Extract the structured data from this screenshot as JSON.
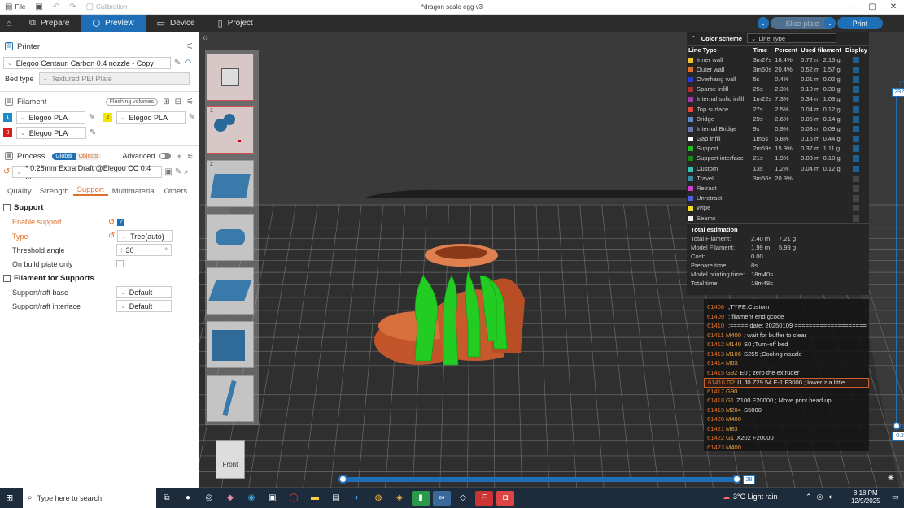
{
  "menubar": {
    "file": "File",
    "calibration": "Calibration",
    "doc_title": "*dragon scale egg v3"
  },
  "tabs": [
    {
      "label": "Prepare"
    },
    {
      "label": "Preview"
    },
    {
      "label": "Device"
    },
    {
      "label": "Project"
    }
  ],
  "toolbar": {
    "slice_label": "Slice plate",
    "print_label": "Print"
  },
  "printer": {
    "section_title": "Printer",
    "profile": "Elegoo Centauri Carbon 0.4 nozzle - Copy",
    "bed_type_label": "Bed type",
    "bed_type_value": "Textured PEI Plate"
  },
  "filament": {
    "section_title": "Filament",
    "flushing_label": "Flushing volumes",
    "slots": [
      {
        "num": "1",
        "name": "Elegoo PLA",
        "color": "#1f8bc4"
      },
      {
        "num": "2",
        "name": "Elegoo PLA",
        "color": "#f2e600"
      },
      {
        "num": "3",
        "name": "Elegoo PLA",
        "color": "#d61c1c"
      }
    ]
  },
  "process": {
    "section_title": "Process",
    "global_label": "Global",
    "objects_label": "Objects",
    "advanced_label": "Advanced",
    "profile": "* 0.28mm Extra Draft @Elegoo CC 0.4 ...",
    "subtabs": [
      "Quality",
      "Strength",
      "Support",
      "Multimaterial",
      "Others"
    ]
  },
  "support": {
    "group_title": "Support",
    "enable_label": "Enable support",
    "type_label": "Type",
    "type_value": "Tree(auto)",
    "threshold_label": "Threshold angle",
    "threshold_value": "30",
    "threshold_unit": "°",
    "build_plate_label": "On build plate only",
    "filament_group_title": "Filament for Supports",
    "base_label": "Support/raft base",
    "base_value": "Default",
    "interface_label": "Support/raft interface",
    "interface_value": "Default"
  },
  "plates": [
    "1",
    "2"
  ],
  "color_scheme": {
    "title": "Color scheme",
    "value": "Line Type",
    "headers": [
      "Line Type",
      "Time",
      "Percent",
      "Used filament",
      "Display"
    ],
    "rows": [
      {
        "name": "Inner wall",
        "color": "#f2c530",
        "time": "3m27s",
        "percent": "18.4%",
        "len": "0.72 m",
        "weight": "2.15 g",
        "display": true
      },
      {
        "name": "Outer wall",
        "color": "#e0702a",
        "time": "3m50s",
        "percent": "20.4%",
        "len": "0.52 m",
        "weight": "1.57 g",
        "display": true
      },
      {
        "name": "Overhang wall",
        "color": "#2a3cd8",
        "time": "5s",
        "percent": "0.4%",
        "len": "0.01 m",
        "weight": "0.02 g",
        "display": true
      },
      {
        "name": "Sparse infill",
        "color": "#b03030",
        "time": "25s",
        "percent": "2.3%",
        "len": "0.10 m",
        "weight": "0.30 g",
        "display": true
      },
      {
        "name": "Internal solid infill",
        "color": "#a03aa8",
        "time": "1m22s",
        "percent": "7.3%",
        "len": "0.34 m",
        "weight": "1.03 g",
        "display": true
      },
      {
        "name": "Top surface",
        "color": "#e04a3a",
        "time": "27s",
        "percent": "2.5%",
        "len": "0.04 m",
        "weight": "0.12 g",
        "display": true
      },
      {
        "name": "Bridge",
        "color": "#5a8ac8",
        "time": "29s",
        "percent": "2.6%",
        "len": "0.05 m",
        "weight": "0.14 g",
        "display": true
      },
      {
        "name": "Internal Bridge",
        "color": "#6a7ab0",
        "time": "9s",
        "percent": "0.9%",
        "len": "0.03 m",
        "weight": "0.09 g",
        "display": true
      },
      {
        "name": "Gap infill",
        "color": "#ffffff",
        "time": "1m5s",
        "percent": "5.8%",
        "len": "0.15 m",
        "weight": "0.44 g",
        "display": true
      },
      {
        "name": "Support",
        "color": "#20c020",
        "time": "2m59s",
        "percent": "15.9%",
        "len": "0.37 m",
        "weight": "1.11 g",
        "display": true
      },
      {
        "name": "Support interface",
        "color": "#1a8a1a",
        "time": "21s",
        "percent": "1.9%",
        "len": "0.03 m",
        "weight": "0.10 g",
        "display": true
      },
      {
        "name": "Custom",
        "color": "#3ac0b0",
        "time": "13s",
        "percent": "1.2%",
        "len": "0.04 m",
        "weight": "0.12 g",
        "display": true
      },
      {
        "name": "Travel",
        "color": "#3a8aa0",
        "time": "3m56s",
        "percent": "20.9%",
        "len": "",
        "weight": "",
        "display": false
      },
      {
        "name": "Retract",
        "color": "#d040d0",
        "time": "",
        "percent": "",
        "len": "",
        "weight": "",
        "display": false
      },
      {
        "name": "Unretract",
        "color": "#5060e0",
        "time": "",
        "percent": "",
        "len": "",
        "weight": "",
        "display": false
      },
      {
        "name": "Wipe",
        "color": "#f0e020",
        "time": "",
        "percent": "",
        "len": "",
        "weight": "",
        "display": false
      },
      {
        "name": "Seams",
        "color": "#f0f0f0",
        "time": "",
        "percent": "",
        "len": "",
        "weight": "",
        "display": false
      }
    ]
  },
  "totals": {
    "title": "Total estimation",
    "rows": [
      {
        "k": "Total Filament:",
        "v": "2.40 m",
        "w": "7.21 g"
      },
      {
        "k": "Model Filament:",
        "v": "1.99 m",
        "w": "5.99 g"
      },
      {
        "k": "Cost:",
        "v": "0.00",
        "w": ""
      },
      {
        "k": "Prepare time:",
        "v": "8s",
        "w": ""
      },
      {
        "k": "Model printing time:",
        "v": "18m40s",
        "w": ""
      },
      {
        "k": "Total time:",
        "v": "18m48s",
        "w": ""
      }
    ]
  },
  "gcode": [
    {
      "ln": "61408",
      "cmd": "",
      "rest": ";TYPE:Custom",
      "hl": false
    },
    {
      "ln": "61409",
      "cmd": "",
      "rest": "; filament end gcode",
      "hl": false
    },
    {
      "ln": "61410",
      "cmd": "",
      "rest": ";===== date: 20250109 ====================",
      "hl": false
    },
    {
      "ln": "61411",
      "cmd": "M400",
      "rest": "; wait for buffer to clear",
      "hl": false
    },
    {
      "ln": "61412",
      "cmd": "M140",
      "rest": "S0 ;Turn-off bed",
      "hl": false
    },
    {
      "ln": "61413",
      "cmd": "M106",
      "rest": "S255 ;Cooling nozzle",
      "hl": false
    },
    {
      "ln": "61414",
      "cmd": "M83",
      "rest": "",
      "hl": false
    },
    {
      "ln": "61415",
      "cmd": "G92",
      "rest": "E0 ; zero the extruder",
      "hl": false
    },
    {
      "ln": "61416",
      "cmd": "G2",
      "rest": "I1 J0 Z29.54 E-1 F3000 ; lower z a little",
      "hl": true
    },
    {
      "ln": "61417",
      "cmd": "G90",
      "rest": "",
      "hl": false
    },
    {
      "ln": "61418",
      "cmd": "G1",
      "rest": "Z100 F20000 ; Move print head up",
      "hl": false
    },
    {
      "ln": "61419",
      "cmd": "M204",
      "rest": "S5000",
      "hl": false
    },
    {
      "ln": "61420",
      "cmd": "M400",
      "rest": "",
      "hl": false
    },
    {
      "ln": "61421",
      "cmd": "M83",
      "rest": "",
      "hl": false
    },
    {
      "ln": "61422",
      "cmd": "G1",
      "rest": "X202 F20000",
      "hl": false
    },
    {
      "ln": "61423",
      "cmd": "M400",
      "rest": "",
      "hl": false
    }
  ],
  "layer_slider": {
    "top_layer": "105",
    "top_height": "29.54",
    "bottom_layer": "1",
    "bottom_height": "0.20"
  },
  "move_slider": {
    "value": "28"
  },
  "view_cube": {
    "label": "Front"
  },
  "taskbar": {
    "search_placeholder": "Type here to search",
    "weather": "3°C  Light rain",
    "time": "8:18 PM",
    "date": "12/9/2025"
  }
}
